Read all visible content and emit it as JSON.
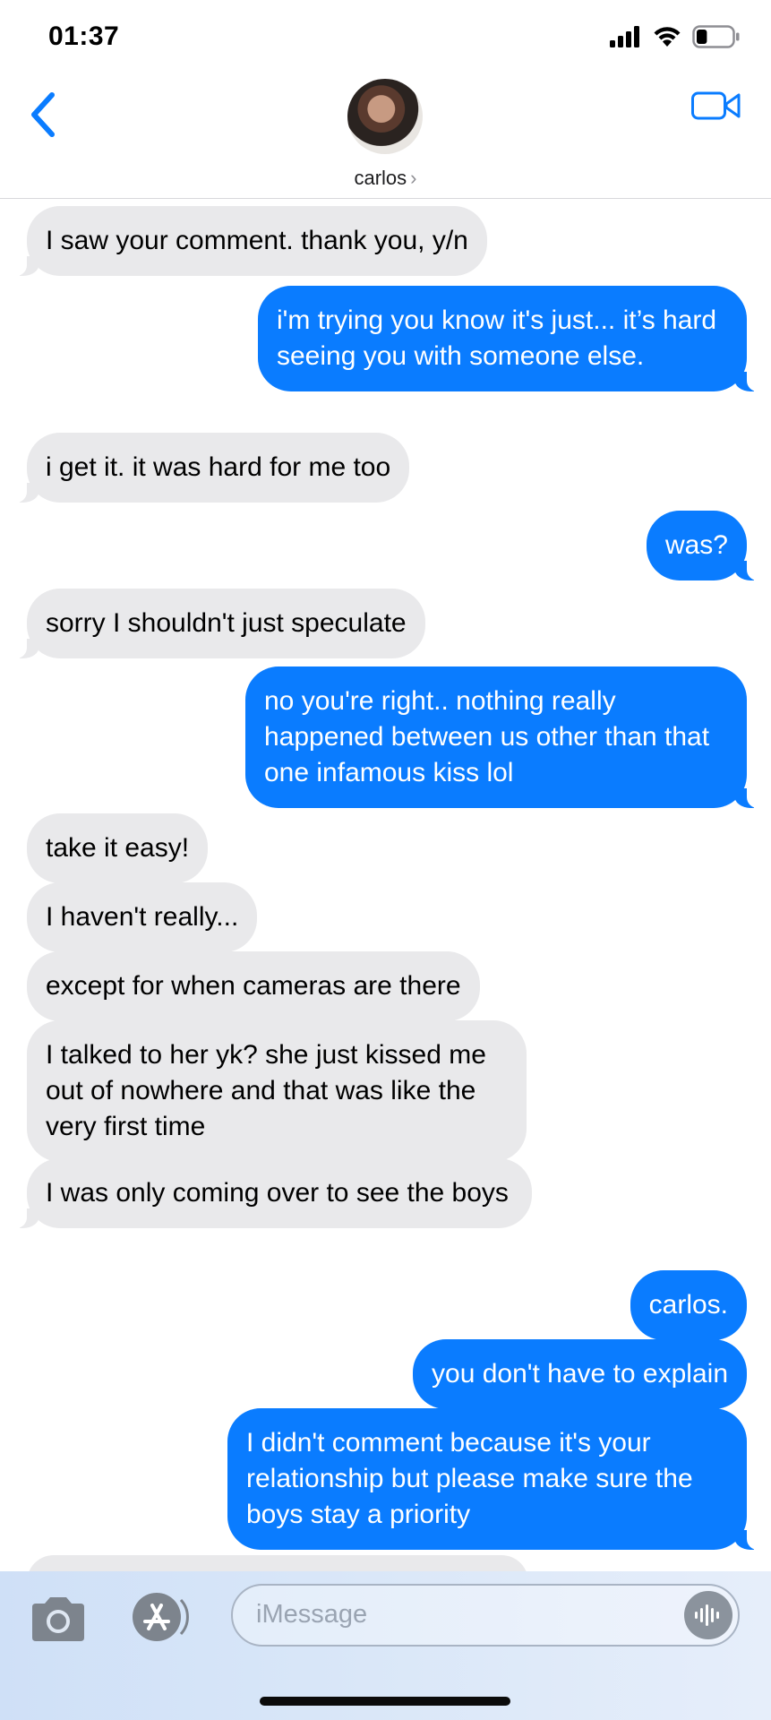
{
  "status_bar": {
    "time": "01:37",
    "battery_level": 0.3
  },
  "header": {
    "contact_name": "carlos",
    "chevron": "›",
    "back_icon": "chevron-left-icon",
    "video_icon": "video-camera-icon"
  },
  "colors": {
    "accent": "#0a7cff",
    "incoming_bubble": "#e9e9eb",
    "outgoing_text": "#ffffff"
  },
  "messages": [
    {
      "dir": "in",
      "text": "I saw your comment. thank you, y/n"
    },
    {
      "dir": "out",
      "text": "i'm trying you know it's just... it’s hard seeing you with someone else."
    },
    {
      "dir": "in",
      "text": "i get it. it was hard for me too"
    },
    {
      "dir": "out",
      "text": "was?"
    },
    {
      "dir": "in",
      "text": "sorry I shouldn't just speculate"
    },
    {
      "dir": "out",
      "text": "no you're right.. nothing really happened between us other than that one infamous kiss lol"
    },
    {
      "dir": "in",
      "text": "take it easy!"
    },
    {
      "dir": "in",
      "text": "I haven't really..."
    },
    {
      "dir": "in",
      "text": "except for when cameras are there"
    },
    {
      "dir": "in",
      "text": "I talked to her yk? she just kissed me out of nowhere and that was like the very first time"
    },
    {
      "dir": "in",
      "text": "I was only coming over to see the boys"
    },
    {
      "dir": "out",
      "text": "carlos."
    },
    {
      "dir": "out",
      "text": "you don't have to explain"
    },
    {
      "dir": "out",
      "text": "I didn't comment because it's your relationship but please make sure the boys stay a priority"
    }
  ],
  "input_bar": {
    "placeholder": "iMessage",
    "camera_icon": "camera-icon",
    "apps_icon": "app-store-icon",
    "voice_icon": "waveform-icon"
  }
}
